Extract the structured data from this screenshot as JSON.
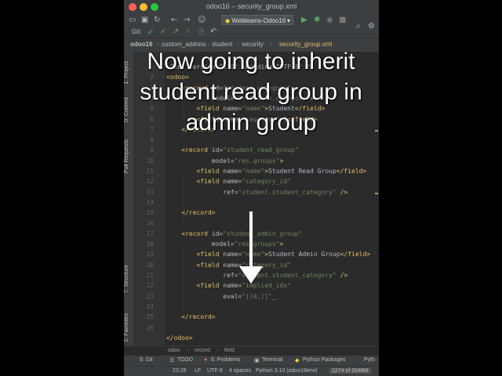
{
  "window": {
    "title": "odoo16 – security_group.xml"
  },
  "toolbar": {
    "run_config": "Webleams-Odoo16",
    "git_label": "Git:"
  },
  "breadcrumb": [
    "odoo16",
    "custom_addons",
    "student",
    "security",
    "security_group.xml"
  ],
  "sidebar": {
    "project": "1: Project",
    "commit": "0: Commit",
    "pull_requests": "Pull Requests",
    "structure": "7: Structure",
    "favorites": "2: Favorites"
  },
  "editor": {
    "line_numbers": [
      "1",
      "2",
      "3",
      "4",
      "5",
      "6",
      "7",
      "8",
      "9",
      "10",
      "11",
      "12",
      "13",
      "14",
      "15",
      "16",
      "17",
      "18",
      "19",
      "20",
      "21",
      "22",
      "23",
      "24",
      "25",
      "26"
    ],
    "lines": [
      {
        "parts": [
          {
            "c": "txt",
            "t": "<?xml version=\"1.0\" encoding=\"UTF-8\" ?>"
          }
        ]
      },
      {
        "parts": [
          {
            "c": "tag",
            "t": "<odoo>"
          }
        ]
      },
      {
        "parts": [
          {
            "c": "txt",
            "t": "    "
          },
          {
            "c": "tag",
            "t": "<record "
          },
          {
            "c": "attr",
            "t": "id="
          },
          {
            "c": "val",
            "t": "\"student_category\""
          }
        ]
      },
      {
        "parts": [
          {
            "c": "txt",
            "t": "            "
          },
          {
            "c": "attr",
            "t": "model="
          },
          {
            "c": "val",
            "t": "\"ir.module.category\""
          },
          {
            "c": "tag",
            "t": ">"
          }
        ]
      },
      {
        "parts": [
          {
            "c": "txt",
            "t": "        "
          },
          {
            "c": "tag",
            "t": "<field "
          },
          {
            "c": "attr",
            "t": "name="
          },
          {
            "c": "val",
            "t": "\"name\""
          },
          {
            "c": "tag",
            "t": ">"
          },
          {
            "c": "txt",
            "t": "Student"
          },
          {
            "c": "tag",
            "t": "</field>"
          }
        ]
      },
      {
        "parts": [
          {
            "c": "txt",
            "t": "        "
          },
          {
            "c": "tag",
            "t": "<field "
          },
          {
            "c": "attr",
            "t": "name="
          },
          {
            "c": "val",
            "t": "\"sequence\""
          },
          {
            "c": "tag",
            "t": ">"
          },
          {
            "c": "txt",
            "t": "1"
          },
          {
            "c": "tag",
            "t": "</field>"
          }
        ]
      },
      {
        "parts": [
          {
            "c": "txt",
            "t": "    "
          },
          {
            "c": "tag",
            "t": "</record>"
          }
        ]
      },
      {
        "parts": []
      },
      {
        "parts": [
          {
            "c": "txt",
            "t": "    "
          },
          {
            "c": "tag",
            "t": "<record "
          },
          {
            "c": "attr",
            "t": "id="
          },
          {
            "c": "val",
            "t": "\"student_read_group\""
          }
        ]
      },
      {
        "parts": [
          {
            "c": "txt",
            "t": "            "
          },
          {
            "c": "attr",
            "t": "model="
          },
          {
            "c": "val",
            "t": "\"res.groups\""
          },
          {
            "c": "tag",
            "t": ">"
          }
        ]
      },
      {
        "parts": [
          {
            "c": "txt",
            "t": "        "
          },
          {
            "c": "tag",
            "t": "<field "
          },
          {
            "c": "attr",
            "t": "name="
          },
          {
            "c": "val",
            "t": "\"name\""
          },
          {
            "c": "tag",
            "t": ">"
          },
          {
            "c": "txt",
            "t": "Student Read Group"
          },
          {
            "c": "tag",
            "t": "</field>"
          }
        ]
      },
      {
        "parts": [
          {
            "c": "txt",
            "t": "        "
          },
          {
            "c": "tag",
            "t": "<field "
          },
          {
            "c": "attr",
            "t": "name="
          },
          {
            "c": "val",
            "t": "\"category_id\""
          }
        ]
      },
      {
        "parts": [
          {
            "c": "txt",
            "t": "               "
          },
          {
            "c": "attr",
            "t": "ref="
          },
          {
            "c": "val",
            "t": "\"student.student_category\""
          },
          {
            "c": "tag",
            "t": " />"
          }
        ]
      },
      {
        "parts": []
      },
      {
        "parts": [
          {
            "c": "txt",
            "t": "    "
          },
          {
            "c": "tag",
            "t": "</record>"
          }
        ]
      },
      {
        "parts": []
      },
      {
        "parts": [
          {
            "c": "txt",
            "t": "    "
          },
          {
            "c": "tag",
            "t": "<record "
          },
          {
            "c": "attr",
            "t": "id="
          },
          {
            "c": "val",
            "t": "\"student_admin_group\""
          }
        ]
      },
      {
        "parts": [
          {
            "c": "txt",
            "t": "            "
          },
          {
            "c": "attr",
            "t": "model="
          },
          {
            "c": "val",
            "t": "\"res.groups\""
          },
          {
            "c": "tag",
            "t": ">"
          }
        ]
      },
      {
        "parts": [
          {
            "c": "txt",
            "t": "        "
          },
          {
            "c": "tag",
            "t": "<field "
          },
          {
            "c": "attr",
            "t": "name="
          },
          {
            "c": "val",
            "t": "\"name\""
          },
          {
            "c": "tag",
            "t": ">"
          },
          {
            "c": "txt",
            "t": "Student Admin Group"
          },
          {
            "c": "tag",
            "t": "</field>"
          }
        ]
      },
      {
        "parts": [
          {
            "c": "txt",
            "t": "        "
          },
          {
            "c": "tag",
            "t": "<field "
          },
          {
            "c": "attr",
            "t": "name="
          },
          {
            "c": "val",
            "t": "\"category_id\""
          }
        ]
      },
      {
        "parts": [
          {
            "c": "txt",
            "t": "               "
          },
          {
            "c": "attr",
            "t": "ref="
          },
          {
            "c": "val",
            "t": "\"student.student_category\""
          },
          {
            "c": "tag",
            "t": " />"
          }
        ]
      },
      {
        "parts": [
          {
            "c": "txt",
            "t": "        "
          },
          {
            "c": "tag",
            "t": "<field "
          },
          {
            "c": "attr",
            "t": "name="
          },
          {
            "c": "val",
            "t": "\"implied_ids\""
          }
        ]
      },
      {
        "parts": [
          {
            "c": "txt",
            "t": "               "
          },
          {
            "c": "attr",
            "t": "eval="
          },
          {
            "c": "val",
            "t": "\"[(4,)]\""
          },
          {
            "c": "txt",
            "t": "_"
          }
        ]
      },
      {
        "parts": []
      },
      {
        "parts": [
          {
            "c": "txt",
            "t": "    "
          },
          {
            "c": "tag",
            "t": "</record>"
          }
        ]
      },
      {
        "parts": []
      },
      {
        "parts": [
          {
            "c": "tag",
            "t": "</odoo>"
          }
        ]
      }
    ]
  },
  "path_bar": [
    "odoo",
    "record",
    "field"
  ],
  "tool_windows": {
    "git": "9: Git",
    "todo": "TODO",
    "problems": "6: Problems",
    "terminal": "Terminal",
    "python_packages": "Python Packages",
    "python_console": "Pyth"
  },
  "status": {
    "position": "23:25",
    "line_sep": "LF",
    "encoding": "UTF-8",
    "indent": "4 spaces",
    "interpreter": "Python 3.10 (odoo16env)",
    "memory": "1274 of 2048M"
  },
  "overlay": {
    "lines": [
      "Now going to inherit",
      "student read group in",
      "admin group"
    ]
  },
  "colors": {
    "tag": "#e8bf6a",
    "attr": "#bababa",
    "value": "#6a8759",
    "text": "#a9b7c6",
    "editor_bg": "#2b2b2b",
    "chrome_bg": "#3c3f41"
  }
}
